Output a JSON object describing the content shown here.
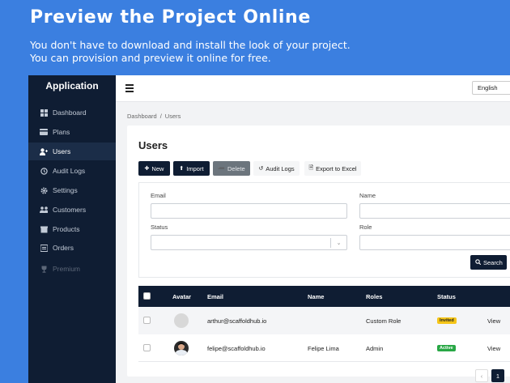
{
  "promo": {
    "title": "Preview the Project Online",
    "line1": "You don't have to download and install the look of your project.",
    "line2": "You can provision and preview it online for free."
  },
  "sidebar": {
    "title": "Application",
    "items": [
      {
        "label": "Dashboard",
        "icon": "dashboard-icon"
      },
      {
        "label": "Plans",
        "icon": "card-icon"
      },
      {
        "label": "Users",
        "icon": "user-plus-icon"
      },
      {
        "label": "Audit Logs",
        "icon": "history-icon"
      },
      {
        "label": "Settings",
        "icon": "gear-icon"
      },
      {
        "label": "Customers",
        "icon": "users-icon"
      },
      {
        "label": "Products",
        "icon": "box-icon"
      },
      {
        "label": "Orders",
        "icon": "list-icon"
      },
      {
        "label": "Premium",
        "icon": "trophy-icon"
      }
    ]
  },
  "topbar": {
    "language": "English"
  },
  "breadcrumb": {
    "root": "Dashboard",
    "sep": "/",
    "current": "Users"
  },
  "page": {
    "title": "Users"
  },
  "toolbar": {
    "new_label": "New",
    "import_label": "Import",
    "delete_label": "Delete",
    "audit_label": "Audit Logs",
    "export_label": "Export to Excel"
  },
  "filters": {
    "email_label": "Email",
    "name_label": "Name",
    "status_label": "Status",
    "role_label": "Role",
    "search_label": "Search"
  },
  "table": {
    "headers": [
      "Avatar",
      "Email",
      "Name",
      "Roles",
      "Status"
    ],
    "rows": [
      {
        "email": "arthur@scaffoldhub.io",
        "name": "",
        "role": "Custom Role",
        "status": "Invited",
        "action": "View"
      },
      {
        "email": "felipe@scaffoldhub.io",
        "name": "Felipe Lima",
        "role": "Admin",
        "status": "Active",
        "action": "View"
      }
    ]
  },
  "pagination": {
    "prev": "‹",
    "current": "1"
  },
  "colors": {
    "brand": "#3b7fe0",
    "sidebar": "#0f1d33",
    "invited": "#f5c518",
    "active": "#28a745"
  }
}
